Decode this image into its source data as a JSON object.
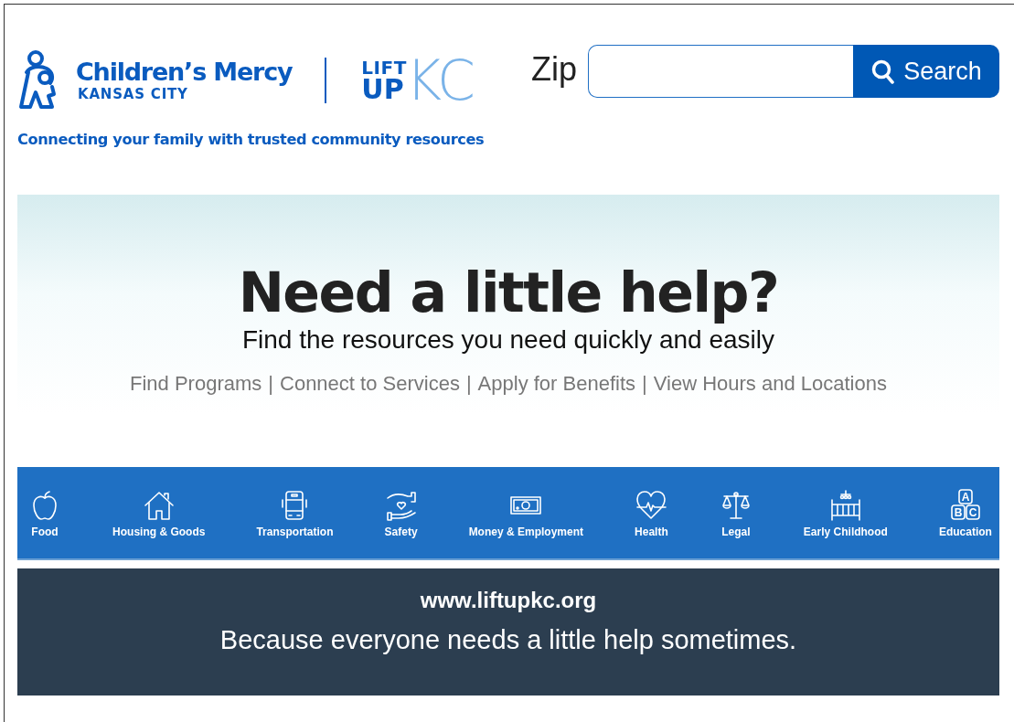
{
  "brand": {
    "name": "Children’s Mercy",
    "subname": "KANSAS CITY",
    "lift": "LIFT",
    "up": "UP",
    "kc": "KC",
    "tagline": "Connecting your family with trusted community resources"
  },
  "search": {
    "label": "Zip",
    "button": "Search"
  },
  "hero": {
    "title": "Need a little help?",
    "subtitle": "Find the resources you need quickly and easily",
    "links": [
      "Find Programs",
      "Connect to Services",
      "Apply for Benefits",
      "View Hours and Locations"
    ],
    "separator": "|"
  },
  "categories": [
    {
      "label": "Food"
    },
    {
      "label": "Housing & Goods"
    },
    {
      "label": "Transportation"
    },
    {
      "label": "Safety"
    },
    {
      "label": "Money & Employment"
    },
    {
      "label": "Health"
    },
    {
      "label": "Legal"
    },
    {
      "label": "Early Childhood"
    },
    {
      "label": "Education",
      "letters": [
        "A",
        "B",
        "C"
      ]
    }
  ],
  "footer": {
    "url": "www.liftupkc.org",
    "slogan": "Because everyone needs a little help sometimes."
  }
}
